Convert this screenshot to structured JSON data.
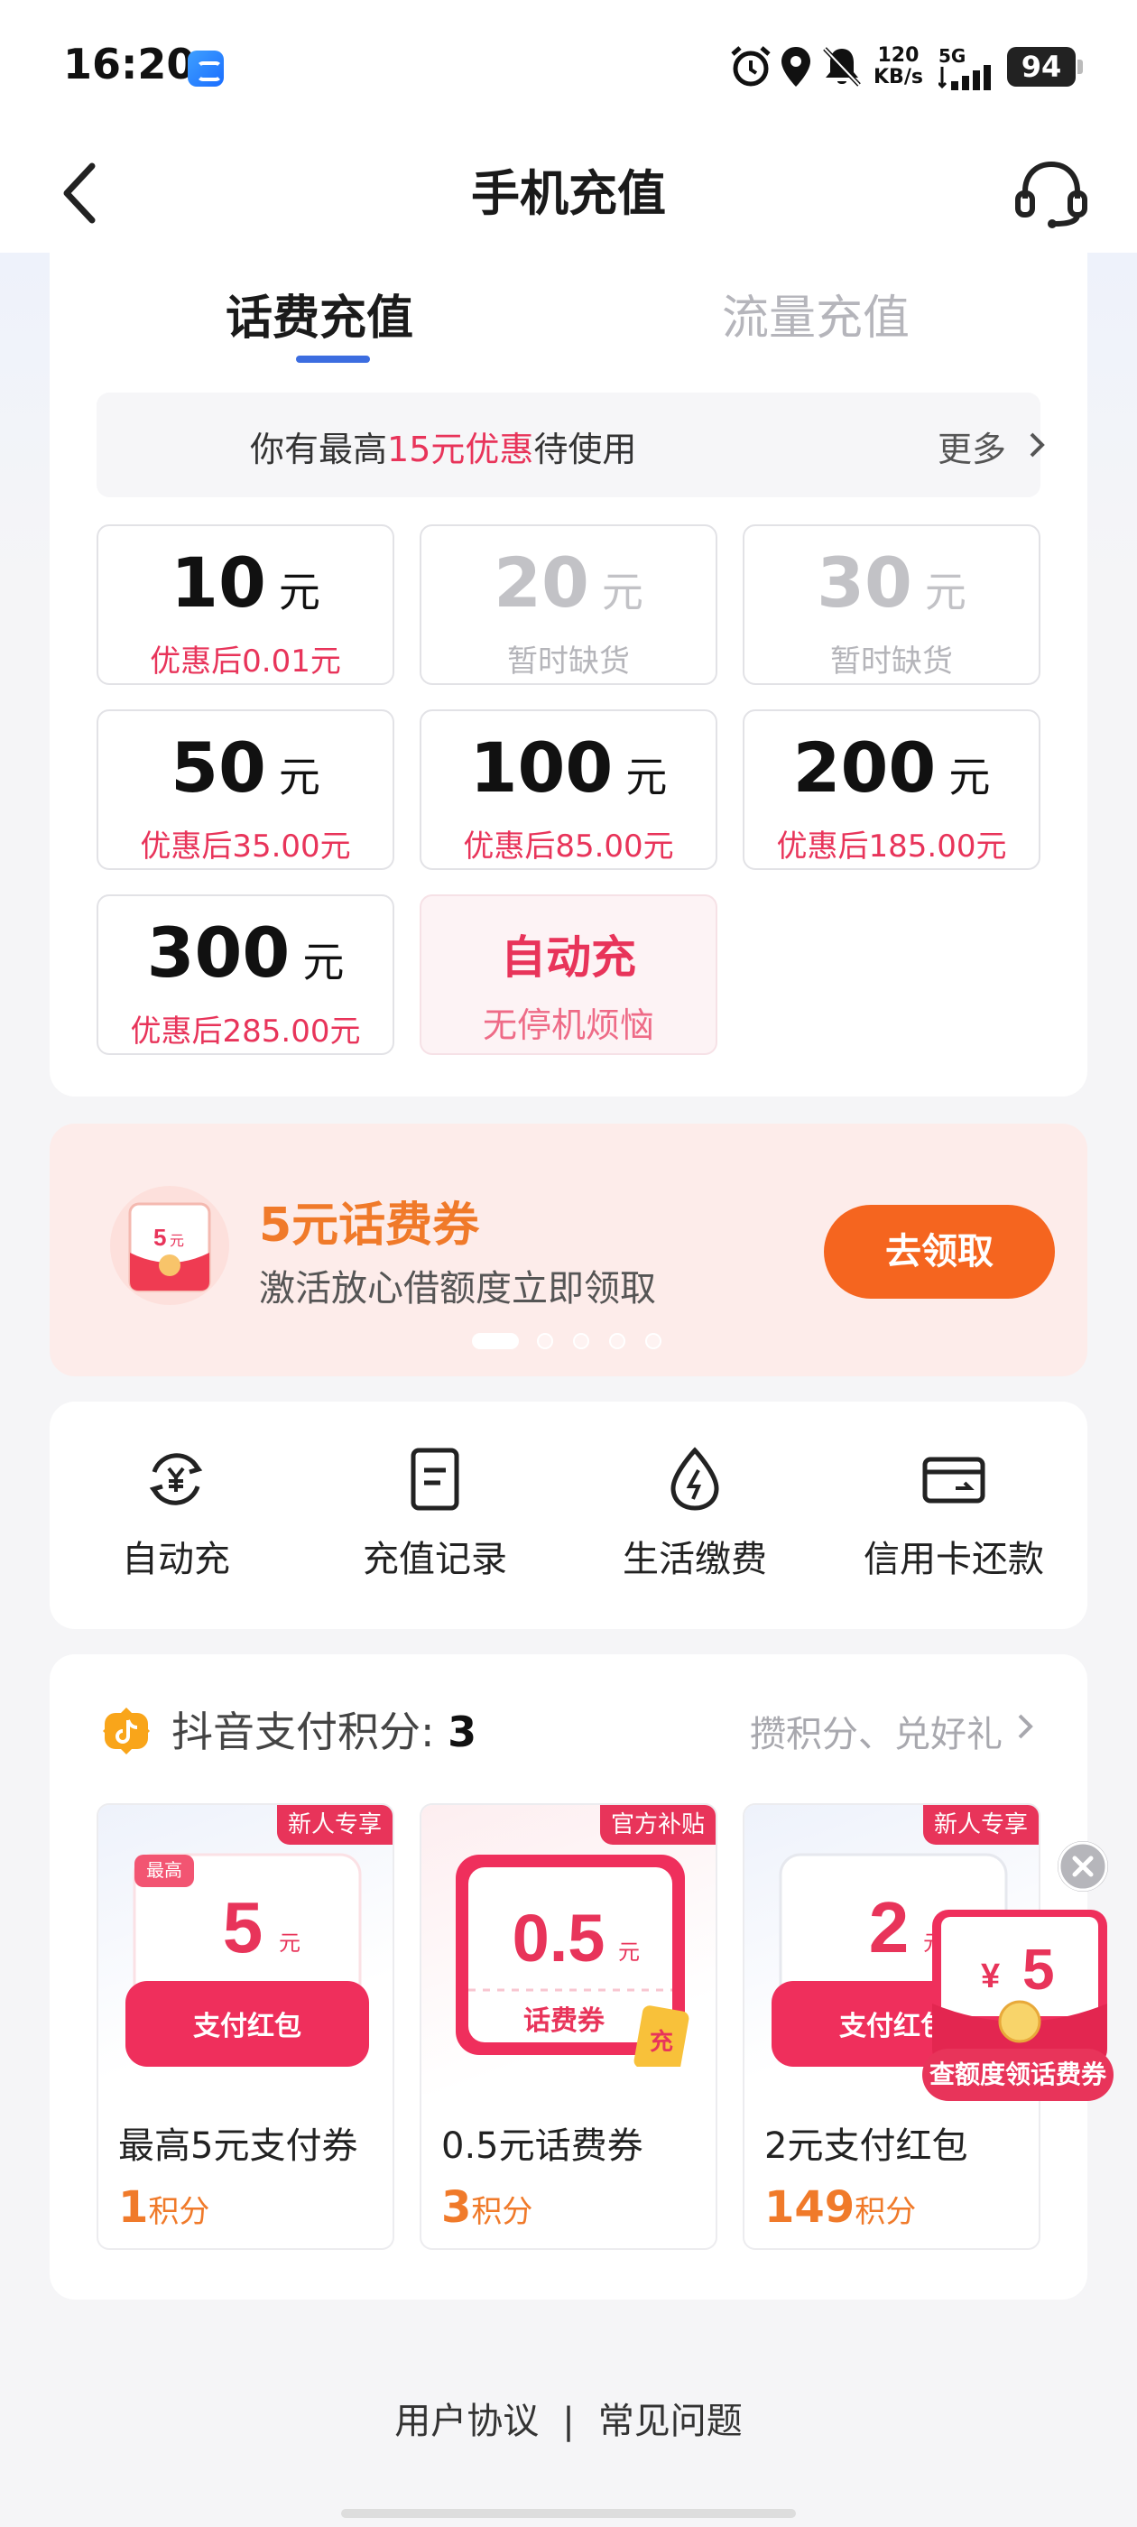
{
  "status_bar": {
    "time": "16:20",
    "net_speed_value": "120",
    "net_speed_unit": "KB/s",
    "network": "5G",
    "battery": "94"
  },
  "nav": {
    "title": "手机充值"
  },
  "tabs": [
    {
      "label": "话费充值",
      "active": true
    },
    {
      "label": "流量充值",
      "active": false
    }
  ],
  "promo": {
    "prefix": "你有最高",
    "highlight": "15元优惠",
    "suffix": "待使用",
    "more": "更多"
  },
  "tiles": [
    {
      "amount": "10",
      "unit": "元",
      "sub": "优惠后0.01元",
      "disabled": false
    },
    {
      "amount": "20",
      "unit": "元",
      "sub": "暂时缺货",
      "disabled": true
    },
    {
      "amount": "30",
      "unit": "元",
      "sub": "暂时缺货",
      "disabled": true
    },
    {
      "amount": "50",
      "unit": "元",
      "sub": "优惠后35.00元",
      "disabled": false
    },
    {
      "amount": "100",
      "unit": "元",
      "sub": "优惠后85.00元",
      "disabled": false
    },
    {
      "amount": "200",
      "unit": "元",
      "sub": "优惠后185.00元",
      "disabled": false
    },
    {
      "amount": "300",
      "unit": "元",
      "sub": "优惠后285.00元",
      "disabled": false
    }
  ],
  "auto_tile": {
    "title": "自动充",
    "sub": "无停机烦恼"
  },
  "banner": {
    "icon_amount": "5",
    "icon_unit": "元",
    "title": "5元话费券",
    "subtitle": "激活放心借额度立即领取",
    "button": "去领取",
    "slides": 5,
    "active_slide": 0
  },
  "services": [
    {
      "label": "自动充",
      "icon": "auto-recharge-icon"
    },
    {
      "label": "充值记录",
      "icon": "record-icon"
    },
    {
      "label": "生活缴费",
      "icon": "utility-icon"
    },
    {
      "label": "信用卡还款",
      "icon": "credit-card-icon"
    }
  ],
  "points": {
    "label": "抖音支付积分: ",
    "value": "3",
    "more": "攒积分、兑好礼"
  },
  "products": [
    {
      "tag": "新人专享",
      "corner": "最高",
      "amount": "5",
      "unit": "元",
      "band": "支付红包",
      "name": "最高5元支付券",
      "price": "1",
      "price_unit": "积分"
    },
    {
      "tag": "官方补贴",
      "amount": "0.5",
      "unit": "元",
      "band": "话费券",
      "badge": "充",
      "name": "0.5元话费券",
      "price": "3",
      "price_unit": "积分"
    },
    {
      "tag": "新人专享",
      "amount": "2",
      "unit": "元",
      "band": "支付红包",
      "name": "2元支付红包",
      "price": "149",
      "price_unit": "积分"
    }
  ],
  "floating": {
    "currency": "¥",
    "amount": "5",
    "label": "查额度领话费券"
  },
  "footer": {
    "agreement": "用户协议",
    "separator": "|",
    "faq": "常见问题"
  },
  "colors": {
    "accent_red": "#e8345a",
    "accent_orange": "#f5651f",
    "tab_indicator": "#3c6de0"
  }
}
